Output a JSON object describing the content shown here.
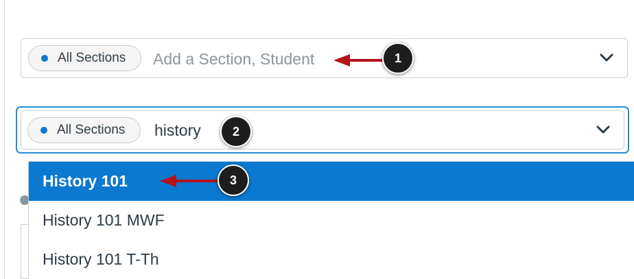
{
  "section_filter_empty": {
    "pill_label": "All Sections",
    "placeholder": "Add a Section, Student"
  },
  "section_filter_search": {
    "pill_label": "All Sections",
    "value": "history"
  },
  "dropdown": {
    "options": [
      {
        "label": "History 101",
        "selected": true
      },
      {
        "label": "History 101 MWF",
        "selected": false
      },
      {
        "label": "History 101 T-Th",
        "selected": false
      }
    ]
  },
  "callouts": [
    "1",
    "2",
    "3"
  ],
  "colors": {
    "accent": "#0b79d0",
    "focus_ring": "#1e90d6",
    "arrow": "#b5121b",
    "badge": "#1d1d1d"
  },
  "icons": {
    "pill_dot": "dot-icon",
    "expand": "chevron-down-icon"
  }
}
